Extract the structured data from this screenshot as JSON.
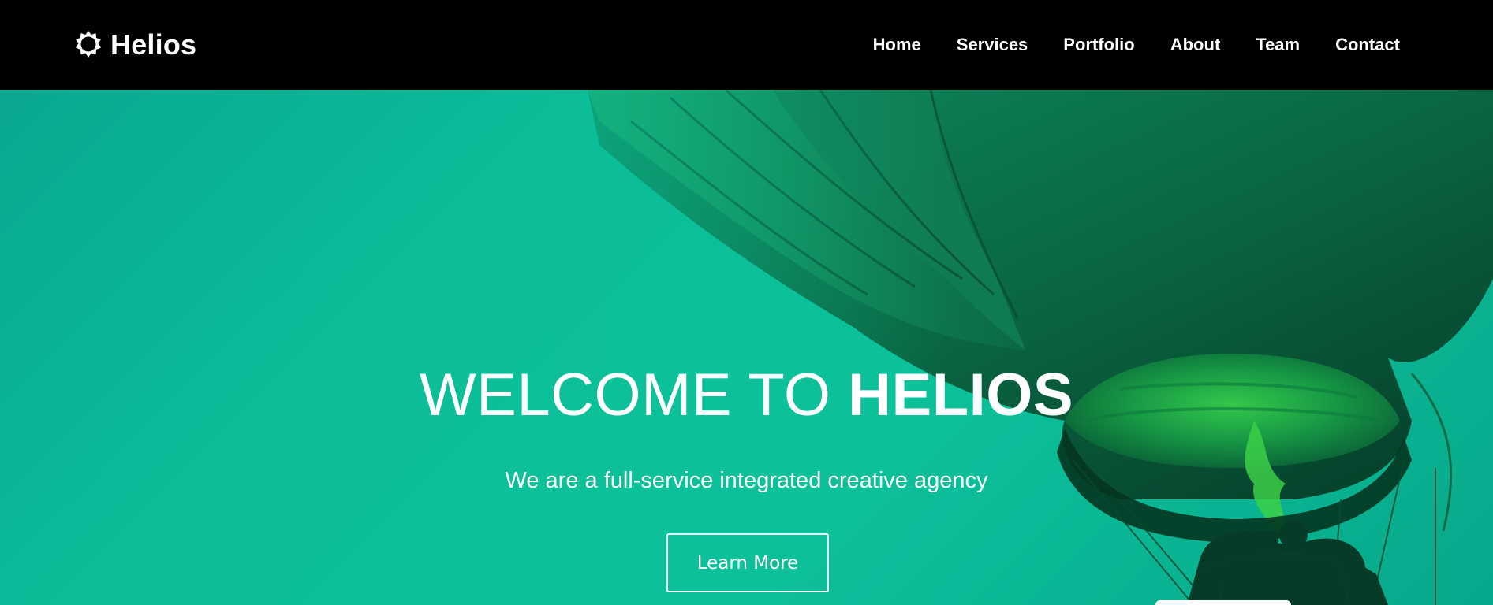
{
  "brand": {
    "name": "Helios",
    "icon": "sun-icon"
  },
  "nav": {
    "items": [
      {
        "label": "Home"
      },
      {
        "label": "Services"
      },
      {
        "label": "Portfolio"
      },
      {
        "label": "About"
      },
      {
        "label": "Team"
      },
      {
        "label": "Contact"
      }
    ]
  },
  "hero": {
    "title_regular": "WELCOME TO ",
    "title_bold": "HELIOS",
    "subtitle": "We are a full-service integrated creative agency",
    "cta_label": "Learn More"
  },
  "colors": {
    "navbar_bg": "#000000",
    "hero_bg": "#0cbf98",
    "text": "#ffffff"
  }
}
